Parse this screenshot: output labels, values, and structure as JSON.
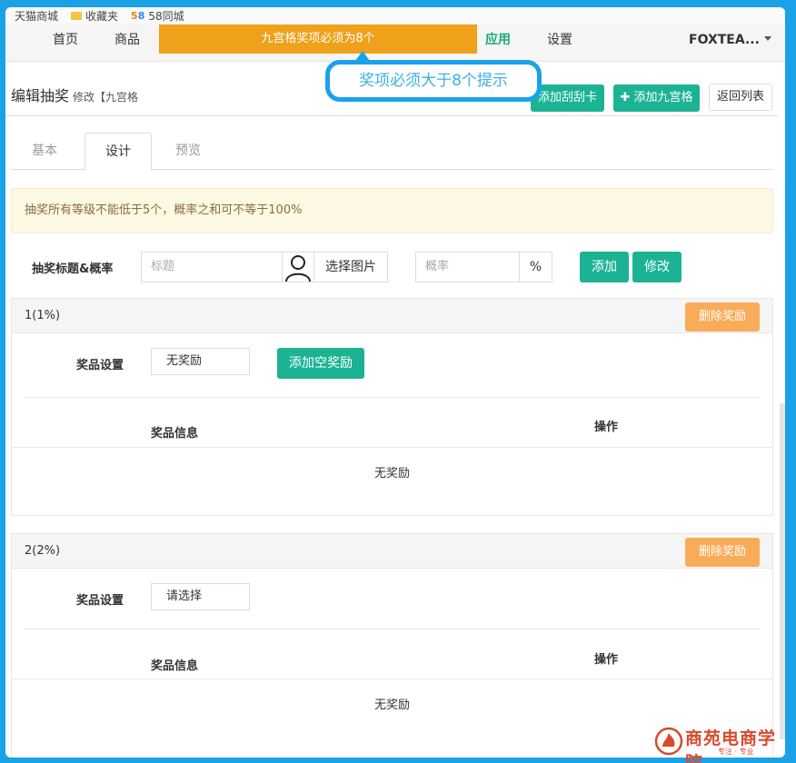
{
  "bookmarks": [
    {
      "label": "天猫商城",
      "icon": "tmall-icon"
    },
    {
      "label": "收藏夹",
      "icon": "folder-icon"
    },
    {
      "label": "58同城",
      "icon": "58-icon"
    }
  ],
  "bookmark_58_badge": {
    "a": "5",
    "b": "8"
  },
  "nav": {
    "home": "首页",
    "goods": "商品",
    "warning": "九宫格奖项必须为8个",
    "apps": "应用",
    "settings": "设置",
    "user": "FOXTEA..."
  },
  "callout": "奖项必须大于8个提示",
  "header": {
    "title": "编辑抽奖",
    "subtitle": "修改【九宫格",
    "btn_scratch": "添加刮刮卡",
    "btn_grid": "添加九宫格",
    "btn_back": "返回列表"
  },
  "tabs": [
    "基本",
    "设计",
    "预览"
  ],
  "alert": "抽奖所有等级不能低于5个，概率之和可不等于100%",
  "form": {
    "label": "抽奖标题&概率",
    "title_placeholder": "标题",
    "choose_image": "选择图片",
    "rate_placeholder": "概率",
    "percent": "%",
    "add": "添加",
    "edit": "修改"
  },
  "panels": [
    {
      "title": "1(1%)",
      "delete": "删除奖励",
      "setting_label": "奖品设置",
      "select_value": "无奖励",
      "add_empty": "添加空奖励",
      "col_info": "奖品信息",
      "col_action": "操作",
      "empty": "无奖励"
    },
    {
      "title": "2(2%)",
      "delete": "删除奖励",
      "setting_label": "奖品设置",
      "select_value": "请选择",
      "col_info": "奖品信息",
      "col_action": "操作",
      "empty": "无奖励"
    }
  ],
  "watermark": {
    "text": "商苑电商学院",
    "sub": "专注 · 专业"
  },
  "colors": {
    "brand_green": "#1cb394",
    "warning_orange": "#eea11a",
    "delete_orange": "#f8ac59",
    "callout_blue": "#19a2ea"
  }
}
